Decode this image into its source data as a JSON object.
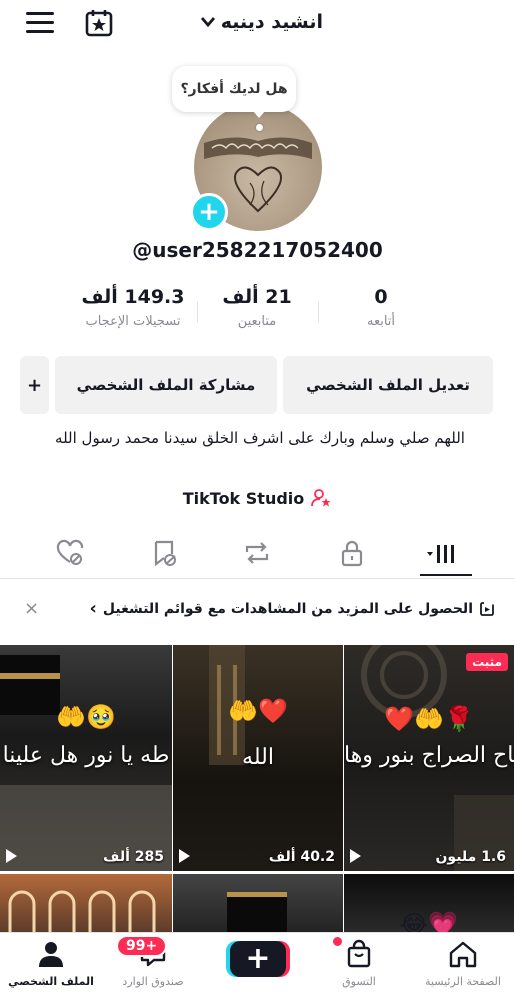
{
  "header": {
    "title": "انشيد دينيه",
    "menu_icon": "menu-icon",
    "calendar_icon": "calendar-star-icon"
  },
  "profile": {
    "thought_bubble": "هل لديك أفكار؟",
    "username": "@user2582217052400",
    "stats": [
      {
        "value": "0",
        "label": "أتابعه"
      },
      {
        "value": "21 ألف",
        "label": "متابعين"
      },
      {
        "value": "149.3 ألف",
        "label": "تسجيلات الإعجاب"
      }
    ],
    "buttons": {
      "edit": "تعديل الملف الشخصي",
      "share": "مشاركة الملف الشخصي",
      "add_friend": "+"
    },
    "bio": "اللهم صلي وسلم وبارك على اشرف الخلق سيدنا محمد رسول الله",
    "studio_link": "TikTok Studio"
  },
  "tabs": [
    {
      "icon": "videos-grid-icon",
      "active": true
    },
    {
      "icon": "lock-icon",
      "active": false
    },
    {
      "icon": "repost-icon",
      "active": false
    },
    {
      "icon": "saved-icon",
      "active": false
    },
    {
      "icon": "liked-icon",
      "active": false
    }
  ],
  "playlist_banner": {
    "text": "الحصول على المزيد من المشاهدات مع قوائم التشغيل",
    "chevron": "›",
    "close": "×"
  },
  "videos": [
    {
      "caption": "طاح الصراج بنور وها",
      "emoji": "❤️🤲🌹",
      "views": "1.6 مليون",
      "pinned_label": "مثبت"
    },
    {
      "caption": "الله",
      "emoji": "🤲❤️",
      "views": "40.2 ألف"
    },
    {
      "caption": "طه يا نور هل علينا",
      "emoji": "🤲🥹",
      "views": "285 ألف"
    },
    {
      "emoji": "😂💗"
    },
    {},
    {}
  ],
  "bottom_nav": {
    "home": "الصفحة الرئيسية",
    "shop": "التسوق",
    "create": "+",
    "inbox": "صندوق الوارد",
    "inbox_badge": "99+",
    "profile": "الملف الشخصي"
  },
  "colors": {
    "accent": "#fe2c55",
    "cyan": "#20d5ec",
    "text": "#161823",
    "muted": "#8a8b91"
  }
}
